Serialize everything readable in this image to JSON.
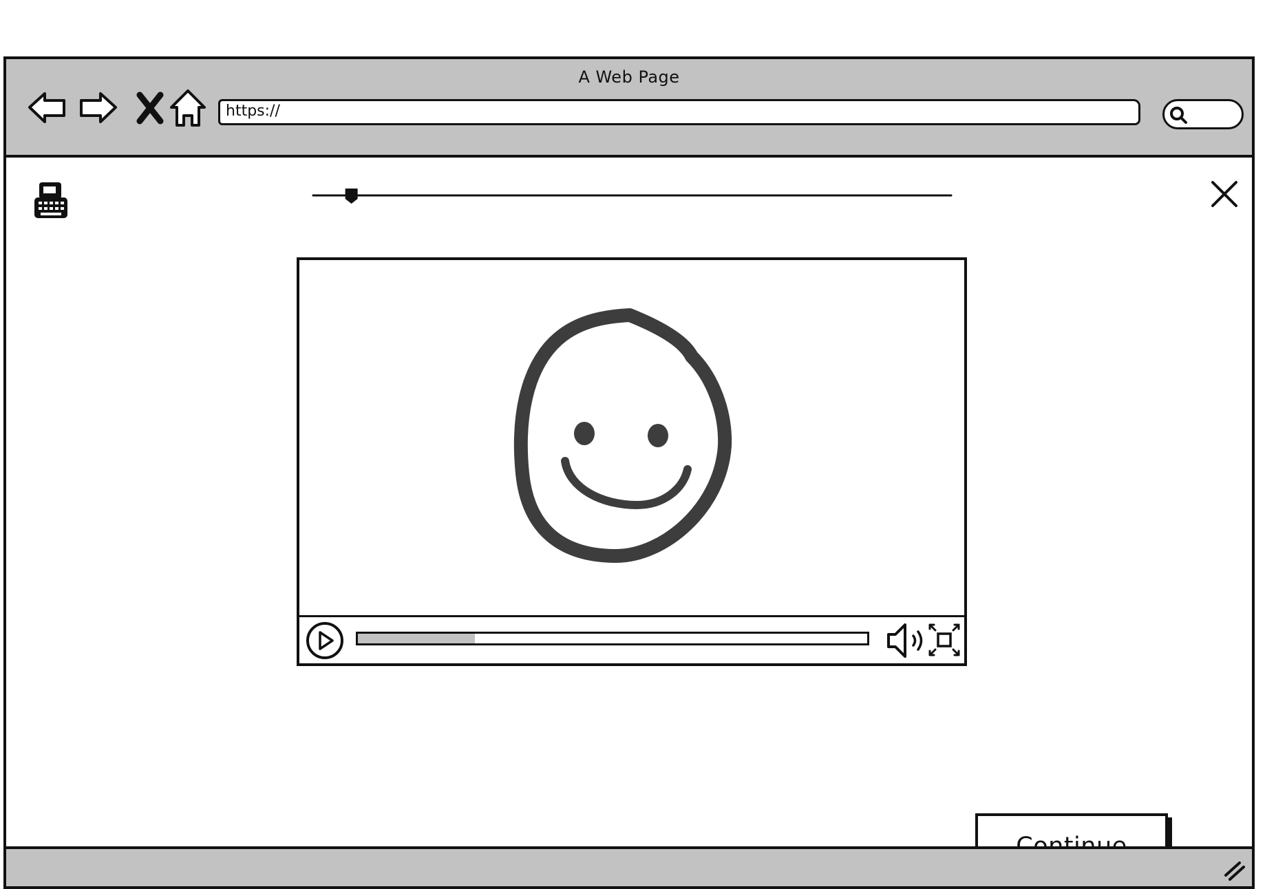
{
  "window": {
    "title": "A Web Page"
  },
  "toolbar": {
    "icons": [
      "back-arrow-icon",
      "forward-arrow-icon",
      "stop-icon",
      "home-icon"
    ],
    "url": "https://",
    "search_icon": "search-icon"
  },
  "content": {
    "typewriter_icon": "typewriter-icon",
    "slider_position": 0.06,
    "close_icon": "close-icon"
  },
  "video": {
    "placeholder_icon": "smiley-face-icon",
    "progress": 0.23,
    "controls": [
      "play-icon",
      "volume-icon",
      "fullscreen-icon"
    ]
  },
  "actions": {
    "continue_label": "Continue"
  },
  "colors": {
    "chrome": "#c2c2c2",
    "ink": "#111111",
    "face": "#3d3d3d",
    "background": "#ffffff"
  }
}
